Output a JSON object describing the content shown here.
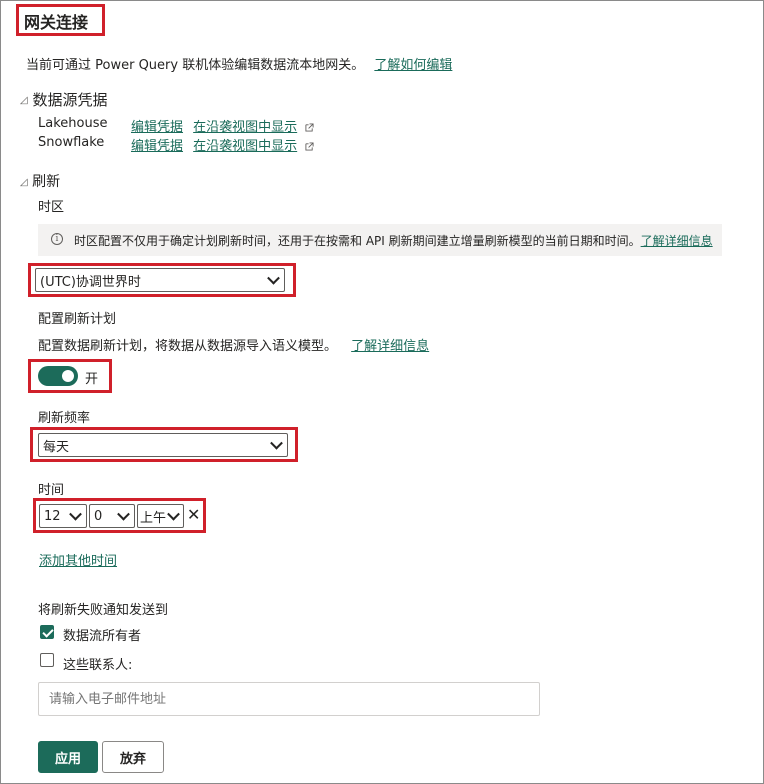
{
  "title": "网关连接",
  "description": "当前可通过 Power Query 联机体验编辑数据流本地网关。",
  "learn_edit_link": "了解如何编辑",
  "datasource_section": {
    "heading": "数据源凭据",
    "items": [
      {
        "name": "Lakehouse",
        "edit_link": "编辑凭据",
        "lineage_link": "在沿袭视图中显示"
      },
      {
        "name": "Snowflake",
        "edit_link": "编辑凭据",
        "lineage_link": "在沿袭视图中显示"
      }
    ]
  },
  "refresh_section": {
    "heading": "刷新",
    "timezone_label": "时区",
    "info_text": "时区配置不仅用于确定计划刷新时间，还用于在按需和 API 刷新期间建立增量刷新模型的当前日期和时间。",
    "info_link": "了解详细信息",
    "timezone_value": "(UTC)协调世界时",
    "schedule_label": "配置刷新计划",
    "schedule_desc": "配置数据刷新计划，将数据从数据源导入语义模型。",
    "schedule_link": "了解详细信息",
    "toggle_label": "开",
    "toggle_on": true,
    "frequency_label": "刷新频率",
    "frequency_value": "每天",
    "time_label": "时间",
    "time_hour": "12",
    "time_minute": "0",
    "time_ampm": "上午",
    "add_time_link": "添加其他时间",
    "notify_label": "将刷新失败通知发送到",
    "notify_owner": "数据流所有者",
    "notify_owner_checked": true,
    "notify_contacts": "这些联系人:",
    "notify_contacts_checked": false,
    "email_placeholder": "请输入电子邮件地址"
  },
  "buttons": {
    "apply": "应用",
    "discard": "放弃"
  },
  "colors": {
    "accent": "#1c6b5a",
    "highlight": "#d0202a"
  }
}
